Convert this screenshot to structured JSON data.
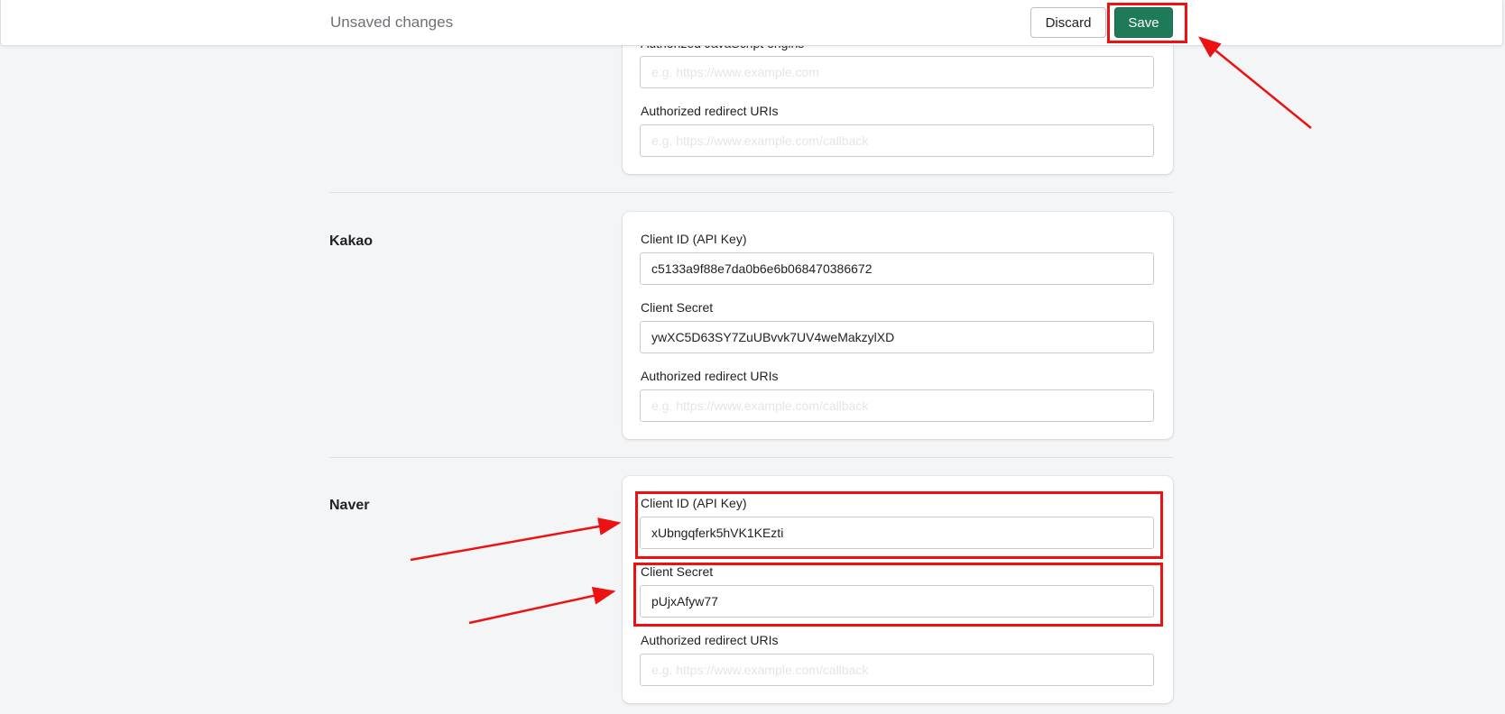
{
  "topbar": {
    "status": "Unsaved changes",
    "discard_label": "Discard",
    "save_label": "Save"
  },
  "sections": {
    "top_card": {
      "partial_label": "Authorized JavaScript origins",
      "partial_placeholder": "e.g. https://www.example.com",
      "redirect_label": "Authorized redirect URIs",
      "redirect_placeholder": "e.g. https://www.example.com/callback"
    },
    "kakao": {
      "title": "Kakao",
      "client_id_label": "Client ID (API Key)",
      "client_id_value": "c5133a9f88e7da0b6e6b068470386672",
      "client_secret_label": "Client Secret",
      "client_secret_value": "ywXC5D63SY7ZuUBvvk7UV4weMakzylXD",
      "redirect_label": "Authorized redirect URIs",
      "redirect_placeholder": "e.g. https://www.example.com/callback"
    },
    "naver": {
      "title": "Naver",
      "client_id_label": "Client ID (API Key)",
      "client_id_value": "xUbngqferk5hVK1KEzti",
      "client_secret_label": "Client Secret",
      "client_secret_value": "pUjxAfyw77",
      "redirect_label": "Authorized redirect URIs",
      "redirect_placeholder": "e.g. https://www.example.com/callback"
    }
  },
  "colors": {
    "accent": "#1f7a57",
    "annotation": "#ee1111",
    "background": "#f4f5f7"
  }
}
